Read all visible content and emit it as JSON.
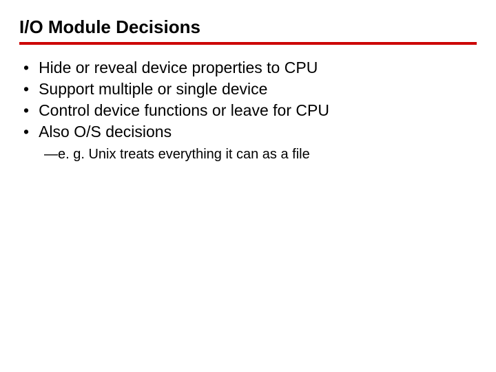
{
  "title": "I/O Module Decisions",
  "bullets": [
    "Hide or reveal device properties to CPU",
    "Support multiple or single device",
    "Control device functions or leave for CPU",
    "Also O/S decisions"
  ],
  "sub": "—e. g. Unix treats everything it can as a file"
}
